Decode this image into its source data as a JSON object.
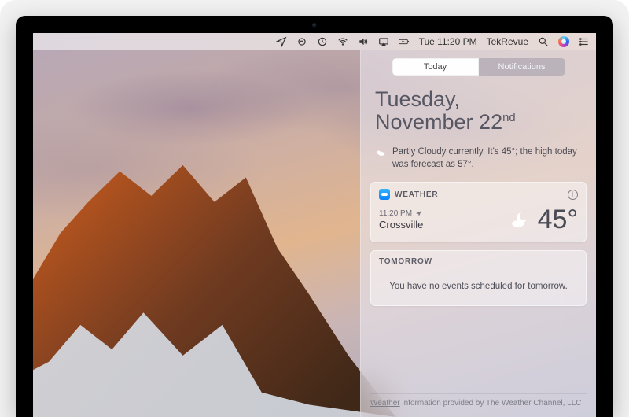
{
  "menubar": {
    "time": "Tue 11:20 PM",
    "user": "TekRevue"
  },
  "nc": {
    "tabs": {
      "today": "Today",
      "notifications": "Notifications"
    },
    "date_line1": "Tuesday,",
    "date_month": "November 22",
    "date_ord": "nd",
    "summary": "Partly Cloudy currently. It's 45°; the high today was forecast as 57°.",
    "weather": {
      "title": "WEATHER",
      "time": "11:20 PM",
      "location": "Crossville",
      "temp": "45°"
    },
    "tomorrow": {
      "title": "TOMORROW",
      "msg": "You have no events scheduled for tomorrow."
    },
    "attrib_link": "Weather",
    "attrib_rest": " information provided by The Weather Channel, LLC"
  }
}
